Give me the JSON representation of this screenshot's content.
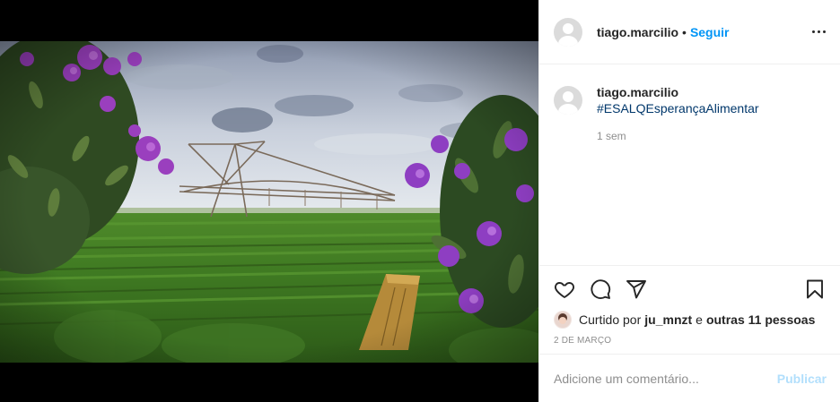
{
  "header": {
    "username": "tiago.marcilio",
    "separator": "•",
    "follow_label": "Seguir"
  },
  "caption": {
    "username": "tiago.marcilio",
    "hashtag": "#ESALQEsperançaAlimentar",
    "time_ago": "1 sem"
  },
  "actions": {
    "like_icon": "heart-icon",
    "comment_icon": "comment-icon",
    "share_icon": "paper-plane-icon",
    "save_icon": "bookmark-icon"
  },
  "likes": {
    "prefix": "Curtido por",
    "user": "ju_mnzt",
    "connector": "e",
    "others": "outras 11 pessoas"
  },
  "post_date": "2 DE MARÇO",
  "comment_box": {
    "placeholder": "Adicione um comentário...",
    "publish_label": "Publicar"
  },
  "colors": {
    "link_blue": "#0095f6",
    "publish_disabled": "#b2dffc",
    "hashtag": "#00376b",
    "muted": "#8e8e8e"
  }
}
